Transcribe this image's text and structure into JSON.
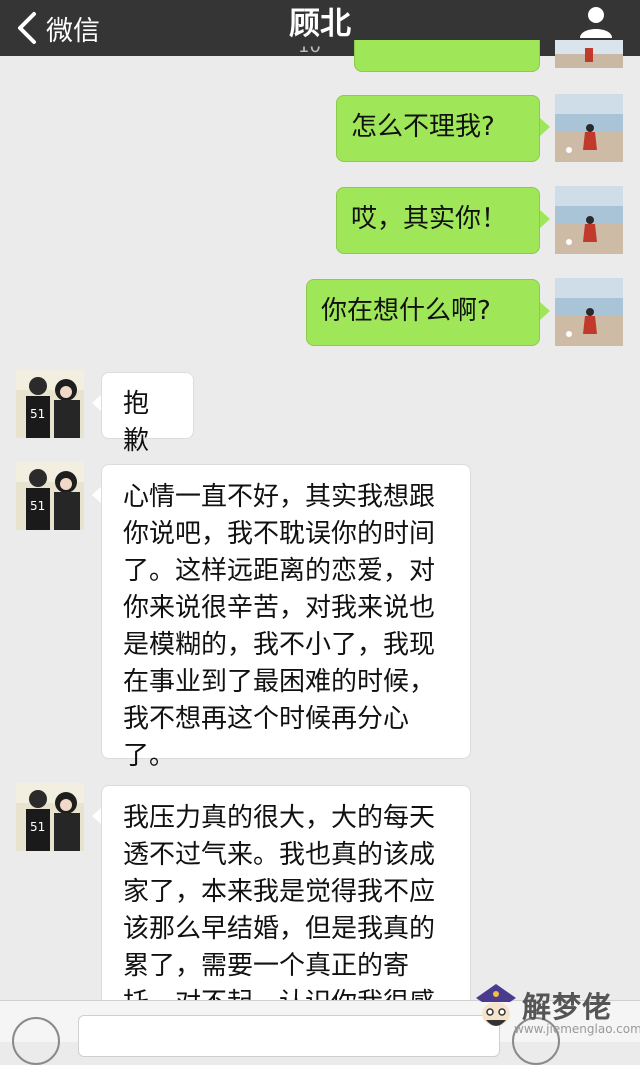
{
  "nav": {
    "back_label": "微信",
    "title": "顾北"
  },
  "timestamp_partial": "10",
  "messages": [
    {
      "side": "sent",
      "text": "怎么不理我?"
    },
    {
      "side": "sent",
      "text": "哎，其实你！"
    },
    {
      "side": "sent",
      "text": "你在想什么啊?"
    },
    {
      "side": "recv",
      "text": "抱歉"
    },
    {
      "side": "recv",
      "text": "心情一直不好，其实我想跟你说吧，我不耽误你的时间了。这样远距离的恋爱，对你来说很辛苦，对我来说也是模糊的，我不小了，我现在事业到了最困难的时候，我不想再这个时候再分心了。"
    },
    {
      "side": "recv",
      "text": "我压力真的很大，大的每天透不过气来。我也真的该成家了，本来我是觉得我不应该那么早结婚，但是我真的累了，需要一个真正的寄托。对不起，认识你我很感"
    }
  ],
  "watermark": {
    "brand": "解梦佬",
    "url": "www.jiemenglao.com"
  },
  "colors": {
    "nav_bg": "#353535",
    "chat_bg": "#ebebeb",
    "sent_bubble": "#9fe658",
    "recv_bubble": "#ffffff"
  },
  "icons": [
    "back-chevron-icon",
    "profile-icon",
    "voice-icon",
    "emoji-icon"
  ]
}
